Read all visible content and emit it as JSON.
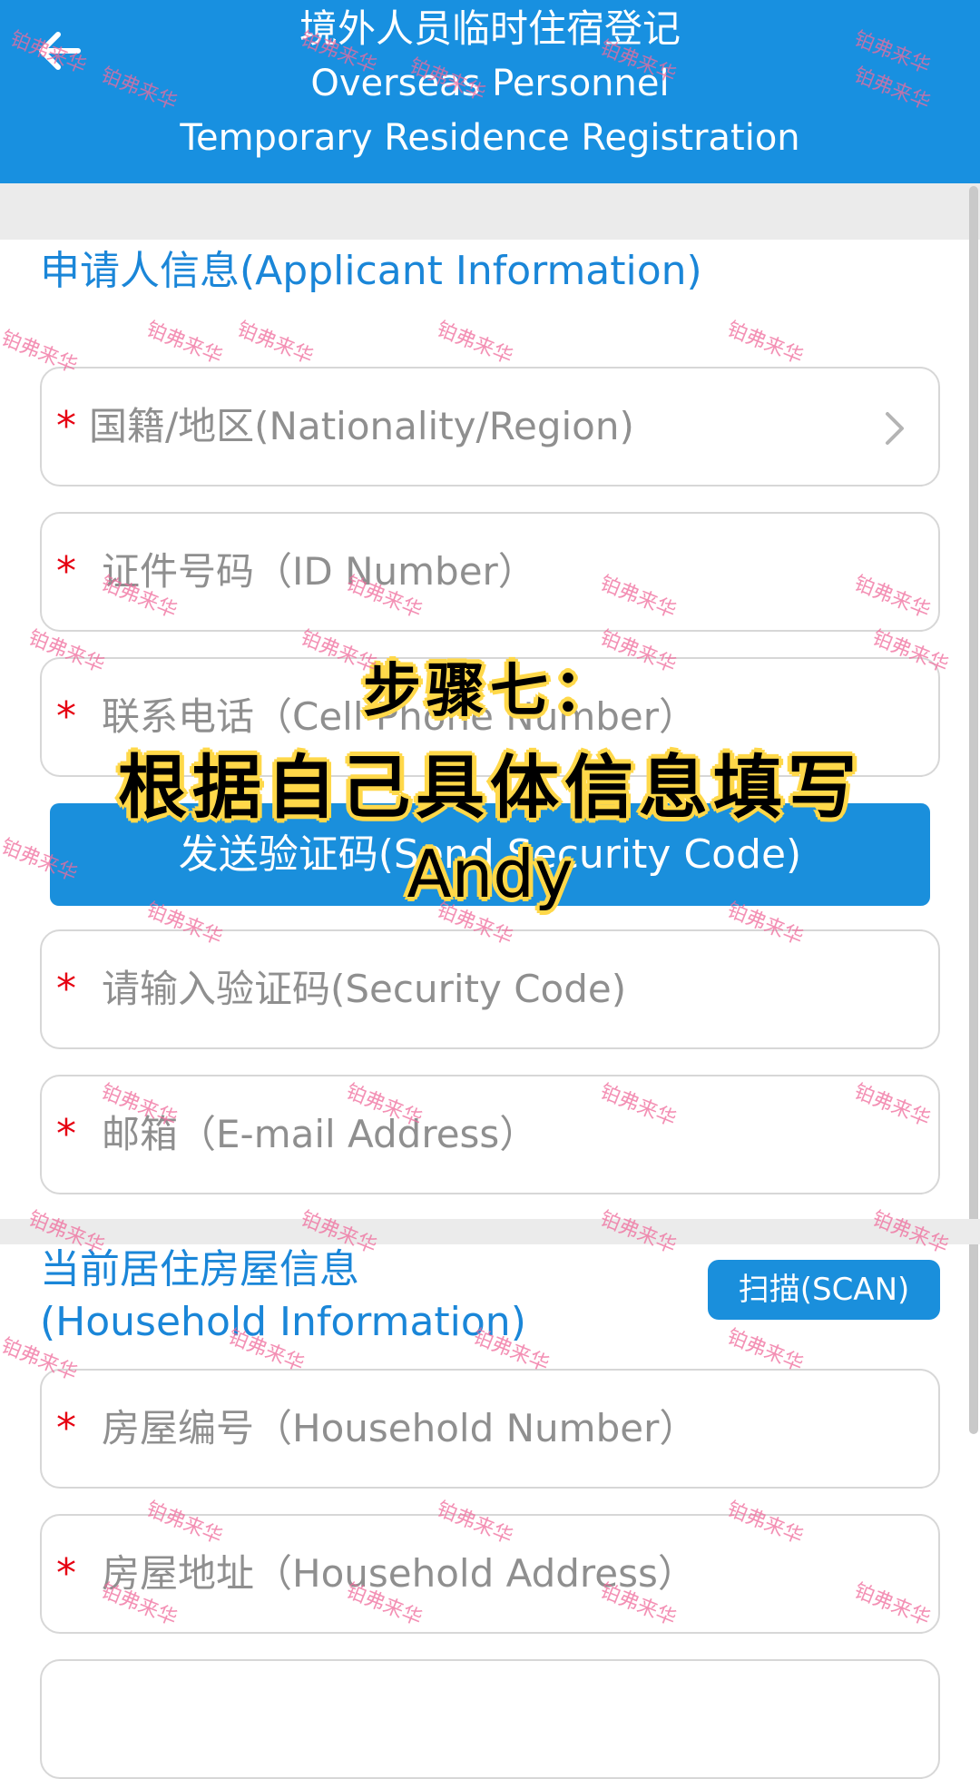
{
  "header": {
    "title_cn": "境外人员临时住宿登记",
    "title_en_1": "Overseas Personnel",
    "title_en_2": "Temporary Residence Registration"
  },
  "applicant": {
    "section_title": "申请人信息(Applicant Information)",
    "fields": [
      {
        "required_mark": "*",
        "label": "国籍/地区(Nationality/Region)"
      },
      {
        "required_mark": "*",
        "label": "证件号码（ID Number）"
      },
      {
        "required_mark": "*",
        "label": "联系电话（Cell Phone Number）"
      },
      {
        "required_mark": "*",
        "label": "请输入验证码(Security Code)"
      },
      {
        "required_mark": "*",
        "label": "邮箱（E-mail Address）"
      }
    ],
    "send_code_label": "发送验证码(Send Security Code)"
  },
  "household": {
    "section_title_1": "当前居住房屋信息",
    "section_title_2": "(Household Information)",
    "scan_label": "扫描(SCAN)",
    "fields": [
      {
        "required_mark": "*",
        "label": "房屋编号（Household Number）"
      },
      {
        "required_mark": "*",
        "label": "房屋地址（Household Address）"
      }
    ]
  },
  "overlay": {
    "line1": "步骤七：",
    "line2": "根据自己具体信息填写",
    "line3": "Andy"
  },
  "watermark": "铂弗来华",
  "colors": {
    "header_bg": "#1890e0",
    "accent_text": "#1a86d8",
    "required": "#e60012",
    "button_bg": "#1a8fdc",
    "overlay_glow": "#ffd84a",
    "watermark": "#f06b9c"
  }
}
